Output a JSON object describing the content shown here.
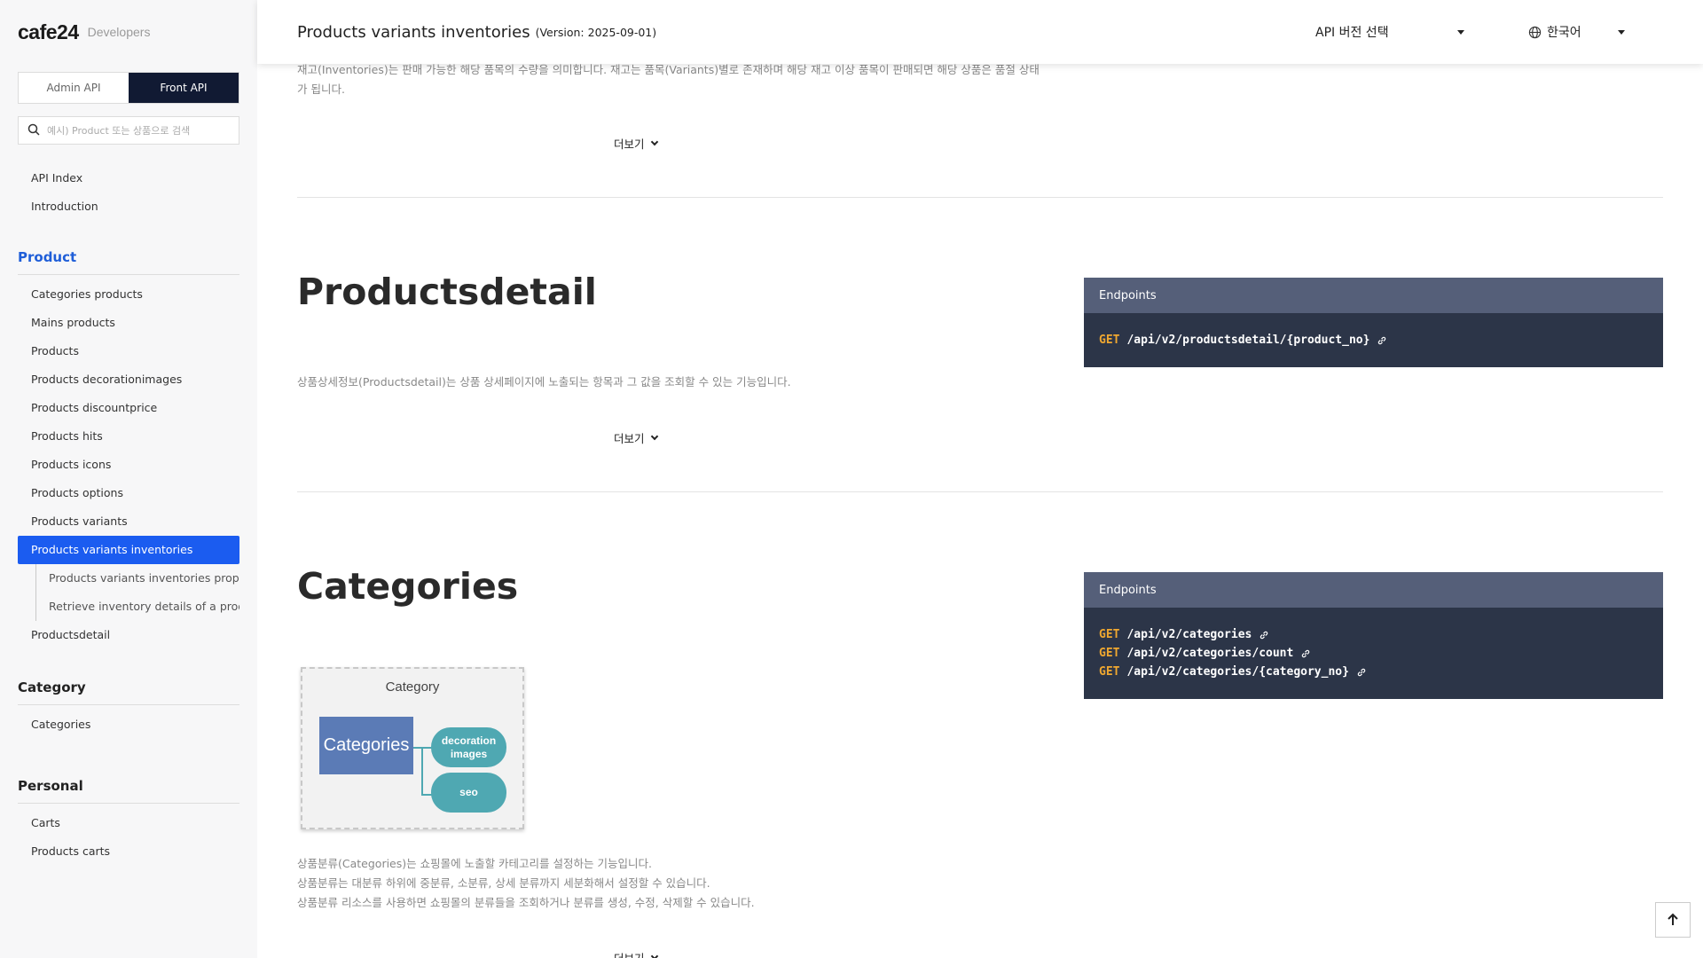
{
  "sidebar": {
    "logo": "cafe24",
    "logo_sub": "Developers",
    "tabs": [
      {
        "label": "Admin API",
        "active": false
      },
      {
        "label": "Front API",
        "active": true
      }
    ],
    "search_placeholder": "예시) Product 또는 상품으로 검색",
    "top_links": [
      "API Index",
      "Introduction"
    ],
    "sections": [
      {
        "title": "Product",
        "items": [
          "Categories products",
          "Mains products",
          "Products",
          "Products decorationimages",
          "Products discountprice",
          "Products hits",
          "Products icons",
          "Products options",
          "Products variants",
          "Products variants inventories",
          "Products variants inventories proper",
          "Retrieve inventory details of a produ",
          "Productsdetail"
        ]
      },
      {
        "title": "Category",
        "items": [
          "Categories"
        ]
      },
      {
        "title": "Personal",
        "items": [
          "Carts",
          "Products carts"
        ]
      }
    ]
  },
  "header": {
    "title": "Products variants inventories",
    "version": "(Version: 2025-09-01)",
    "version_select": "API 버전 선택",
    "language": "한국어"
  },
  "content": {
    "intro_line1": "재고(Inventories)는 판매 가능한 해당 품목의 수량을 의미합니다. 재고는 품목(Variants)별로 존재하며 해당 재고 이상 품목이 판매되면 해당 상품은 품절 상태",
    "intro_line2": "가 됩니다.",
    "more_label": "더보기",
    "productsdetail": {
      "title": "Productsdetail",
      "desc": "상품상세정보(Productsdetail)는 상품 상세페이지에 노출되는 항목과 그 값을 조회할 수 있는 기능입니다.",
      "endpoints_title": "Endpoints",
      "endpoints": [
        {
          "method": "GET",
          "path": "/api/v2/productsdetail/{product_no}"
        }
      ]
    },
    "categories": {
      "title": "Categories",
      "desc_lines": [
        "상품분류(Categories)는 쇼핑몰에 노출할 카테고리를 설정하는 기능입니다.",
        "상품분류는 대분류 하위에 중분류, 소분류, 상세 분류까지 세분화해서 설정할 수 있습니다.",
        "상품분류 리소스를 사용하면 쇼핑몰의 분류들을 조회하거나 분류를 생성, 수정, 삭제할 수 있습니다."
      ],
      "endpoints_title": "Endpoints",
      "endpoints": [
        {
          "method": "GET",
          "path": "/api/v2/categories"
        },
        {
          "method": "GET",
          "path": "/api/v2/categories/count"
        },
        {
          "method": "GET",
          "path": "/api/v2/categories/{category_no}"
        }
      ],
      "diagram": {
        "title": "Category",
        "main": "Categories",
        "children": [
          "decoration images",
          "seo"
        ]
      }
    }
  },
  "colors": {
    "active_blue": "#1b5cf0",
    "dark_navy": "#111a33",
    "endpoint_bg": "#2c3548",
    "endpoint_head": "#555f79",
    "method_orange": "#f0a830"
  }
}
